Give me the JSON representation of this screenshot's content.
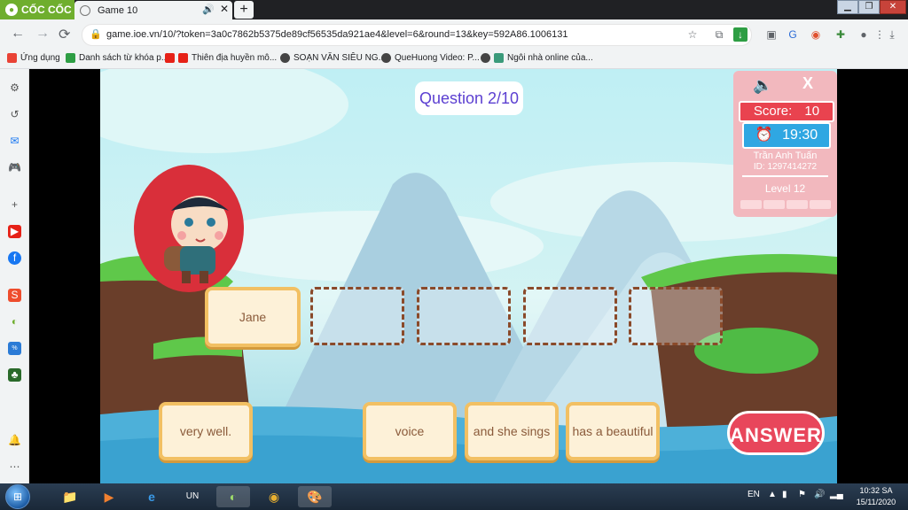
{
  "browser": {
    "brand": "CỐC CỐC",
    "tab_title": "Game 10",
    "url": "game.ioe.vn/10/?token=3a0c7862b5375de89cf56535da921ae4&level=6&round=13&key=592A86.1006131",
    "bookmarks": [
      "Ứng dụng",
      "Danh sách từ khóa p...",
      "Thiên địa huyền mô...",
      "SOẠN VĂN SIÊU NG...",
      "QueHuong Video: P...",
      "Ngôi nhà online của..."
    ]
  },
  "game": {
    "question_label": "Question 2/10",
    "placed_words": [
      "Jane"
    ],
    "word_bank": [
      "very well.",
      "voice",
      "and she sings",
      "has a beautiful"
    ],
    "answer_label": "ANSWER",
    "hud": {
      "score_label": "Score:",
      "score_value": "10",
      "timer": "19:30",
      "player_name": "Trần Anh Tuấn",
      "player_id": "ID: 1297414272",
      "level": "Level 12",
      "close": "X"
    }
  },
  "taskbar": {
    "language": "EN",
    "time": "10:32 SA",
    "date": "15/11/2020"
  },
  "colors": {
    "accent_green": "#6fae2e",
    "answer_red": "#e8465b",
    "score_red": "#e9434f",
    "timer_blue": "#2fa7e2",
    "question_purple": "#5b3fd1"
  }
}
